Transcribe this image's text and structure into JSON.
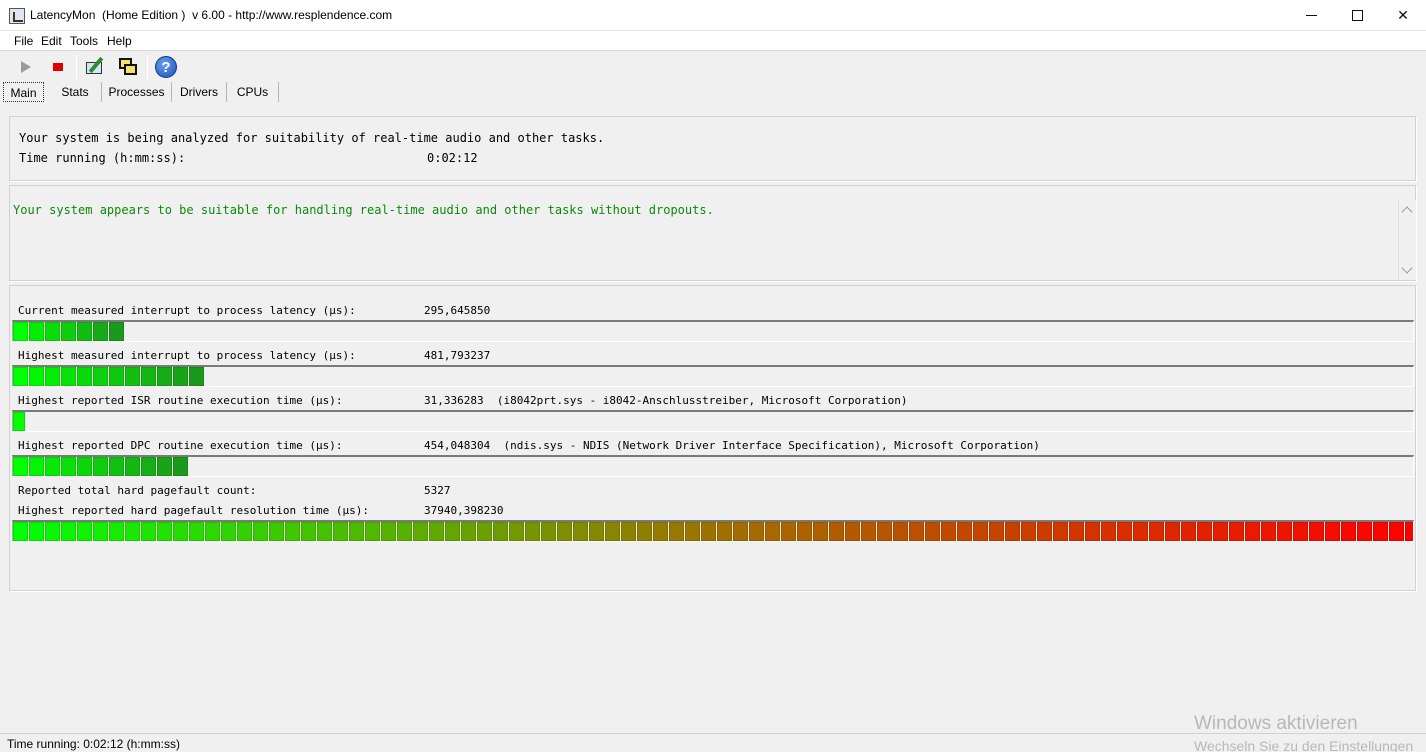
{
  "window": {
    "title": "LatencyMon  (Home Edition )  v 6.00 - http://www.resplendence.com",
    "close_glyph": "✕"
  },
  "menu": [
    "File",
    "Edit",
    "Tools",
    "Help"
  ],
  "toolbar": {
    "buttons": [
      "play-icon",
      "stop-icon",
      "tools-icon",
      "windows-icon",
      "help-icon"
    ],
    "help_glyph": "?"
  },
  "tabs": [
    "Main",
    "Stats",
    "Processes",
    "Drivers",
    "CPUs"
  ],
  "analysis": {
    "line1": "Your system is being analyzed for suitability of real-time audio and other tasks.",
    "time_label": "Time running (h:mm:ss):",
    "time_value": "0:02:12"
  },
  "verdict": {
    "text": "Your system appears to be suitable for handling real-time audio and other tasks without dropouts.",
    "color": "#0a8a0a"
  },
  "metrics": [
    {
      "label": "Current measured interrupt to process latency (µs):",
      "value": "295,645850",
      "meter_segments": 7,
      "color_start": "#00ff00",
      "color_end": "#1a9a1a"
    },
    {
      "label": "Highest measured interrupt to process latency (µs):",
      "value": "481,793237",
      "meter_segments": 12,
      "color_start": "#00ff00",
      "color_end": "#1a9a1a"
    },
    {
      "label": "Highest reported ISR routine execution time (µs):",
      "value": "31,336283  (i8042prt.sys - i8042-Anschlusstreiber, Microsoft Corporation)",
      "meter_segments": 1,
      "color_start": "#00ff00",
      "color_end": "#1a9a1a"
    },
    {
      "label": "Highest reported DPC routine execution time (µs):",
      "value": "454,048304  (ndis.sys - NDIS (Network Driver Interface Specification), Microsoft Corporation)",
      "meter_segments": 11,
      "color_start": "#00ff00",
      "color_end": "#1a9a1a"
    }
  ],
  "pagefault": {
    "count_label": "Reported total hard pagefault count:",
    "count_value": "5327",
    "resolution_label": "Highest reported hard pagefault resolution time (µs):",
    "resolution_value": "37940,398230",
    "meter_segments": 88,
    "color_start": "#00ff00",
    "color_mid": "#a07000",
    "color_end": "#ff0000"
  },
  "status": {
    "text": "Time running: 0:02:12  (h:mm:ss)"
  },
  "watermark": {
    "line1": "Windows aktivieren",
    "line2": "Wechseln Sie zu den Einstellungen"
  }
}
